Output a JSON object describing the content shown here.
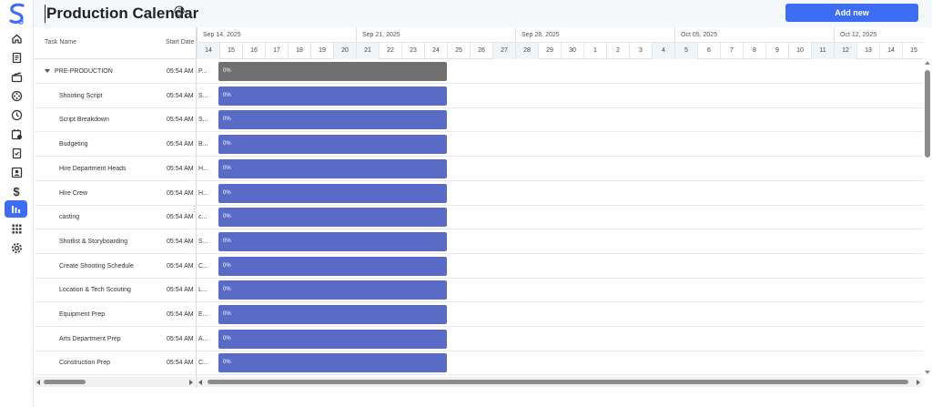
{
  "header": {
    "title": "Production Calendar",
    "add_label": "Add new"
  },
  "sidebar": {
    "items": [
      {
        "icon": "home-icon"
      },
      {
        "icon": "document-icon"
      },
      {
        "icon": "clapperboard-icon"
      },
      {
        "icon": "film-reel-icon"
      },
      {
        "icon": "clock-icon"
      },
      {
        "icon": "calendar-clock-icon"
      },
      {
        "icon": "checklist-icon"
      },
      {
        "icon": "contact-card-icon"
      },
      {
        "icon": "dollar-icon",
        "glyph": "$"
      },
      {
        "icon": "gantt-chart-icon",
        "active": true
      },
      {
        "icon": "apps-grid-icon"
      },
      {
        "icon": "gear-icon"
      }
    ]
  },
  "grid": {
    "columns": {
      "task_name": "Task Name",
      "start_date": "Start Date"
    }
  },
  "timeline": {
    "weeks": [
      "Sep 14, 2025",
      "Sep 21, 2025",
      "Sep 28, 2025",
      "Oct 05, 2025",
      "Oct 12, 2025"
    ],
    "days": [
      "14",
      "15",
      "16",
      "17",
      "18",
      "19",
      "20",
      "21",
      "22",
      "23",
      "24",
      "25",
      "26",
      "27",
      "28",
      "29",
      "30",
      "1",
      "2",
      "3",
      "4",
      "5",
      "6",
      "7",
      "8",
      "9",
      "10",
      "11",
      "12",
      "13",
      "14",
      "15"
    ]
  },
  "tasks": [
    {
      "name": "PRE-PRODUCTION",
      "start": "05:54 AM",
      "short": "P...",
      "progress": "0%",
      "parent": true
    },
    {
      "name": "Shooting Script",
      "start": "05:54 AM",
      "short": "S...",
      "progress": "0%"
    },
    {
      "name": "Script Breakdown",
      "start": "05:54 AM",
      "short": "S...",
      "progress": "0%"
    },
    {
      "name": "Budgeting",
      "start": "05:54 AM",
      "short": "B...",
      "progress": "0%"
    },
    {
      "name": "Hire Department Heads",
      "start": "05:54 AM",
      "short": "H...",
      "progress": "0%"
    },
    {
      "name": "Hire Crew",
      "start": "05:54 AM",
      "short": "H...",
      "progress": "0%"
    },
    {
      "name": "casting",
      "start": "05:54 AM",
      "short": "c...",
      "progress": "0%"
    },
    {
      "name": "Shotlist & Storyboarding",
      "start": "05:54 AM",
      "short": "S...",
      "progress": "0%"
    },
    {
      "name": "Create Shooting Schedule",
      "start": "05:54 AM",
      "short": "C...",
      "progress": "0%"
    },
    {
      "name": "Location & Tech Scouting",
      "start": "05:54 AM",
      "short": "L...",
      "progress": "0%"
    },
    {
      "name": "Equipment Prep",
      "start": "05:54 AM",
      "short": "E...",
      "progress": "0%"
    },
    {
      "name": "Arts Department Prep",
      "start": "05:54 AM",
      "short": "A...",
      "progress": "0%"
    },
    {
      "name": "Construction Prep",
      "start": "05:54 AM",
      "short": "C...",
      "progress": "0%"
    }
  ],
  "colors": {
    "accent": "#3d6df2",
    "bar": "#5a6bc6",
    "parent_bar": "#707070"
  }
}
